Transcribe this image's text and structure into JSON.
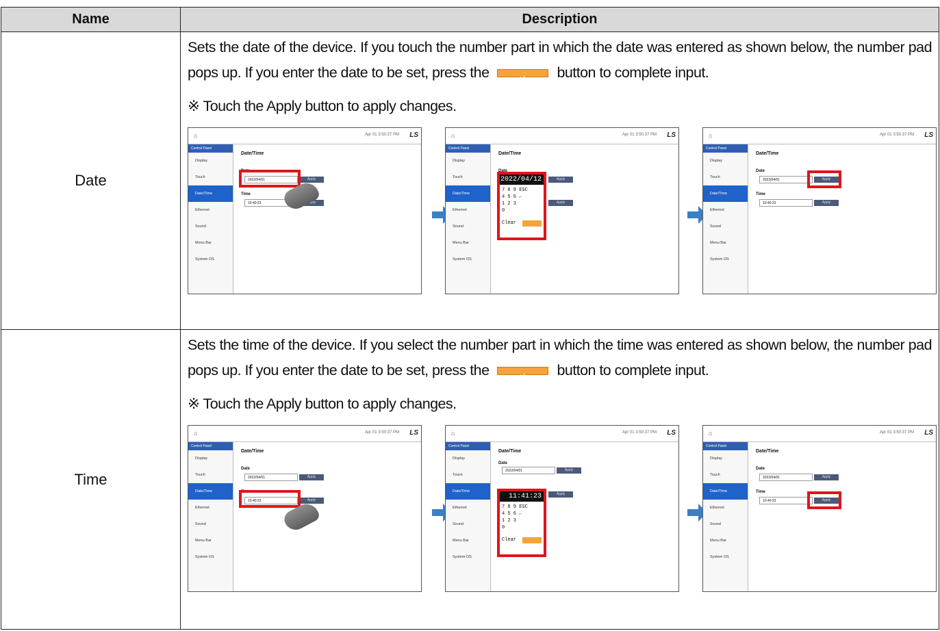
{
  "table": {
    "col_name": "Name",
    "col_desc": "Description",
    "rows": [
      {
        "name": "Date",
        "para1": "Sets the date of the device. If you touch the number part in which the date was entered as shown below, the number pad pops up. If you enter the date to be set, press the",
        "para2": "button to complete input.",
        "note": "※ Touch the Apply button to apply changes."
      },
      {
        "name": "Time",
        "para1": "Sets the time of the device. If you select the number part in which the time was entered as shown below, the number pad pops up. If you enter the date to be set, press the",
        "para2": "button to complete input.",
        "note": "※ Touch the Apply button to apply changes."
      }
    ]
  },
  "screen": {
    "control_panel": "Control Panel",
    "menu": [
      "Display",
      "Touch",
      "Date/Time",
      "Ethernet",
      "Sound",
      "Menu Bar",
      "System OS"
    ],
    "pane_title": "Date/Time",
    "date_label": "Date",
    "time_label": "Time",
    "apply": "Apply",
    "status": "Apr 01 3:50:37 PM",
    "brand": "LS",
    "date_value": "2022/04/01",
    "time_value": "10:40:23",
    "pad_date": "2022/04/12",
    "pad_time": "11:41:23",
    "pad_row1": "7  8  9  ESC",
    "pad_row2": "4  5  6  ←",
    "pad_row3": "1  2  3",
    "pad_row4": "0",
    "pad_clear": "Clear"
  },
  "colors": {
    "highlight": "#e0141b",
    "arrow": "#3b7fc4",
    "ok_button": "#f5a43a",
    "header_bg": "#d9d9d9"
  }
}
